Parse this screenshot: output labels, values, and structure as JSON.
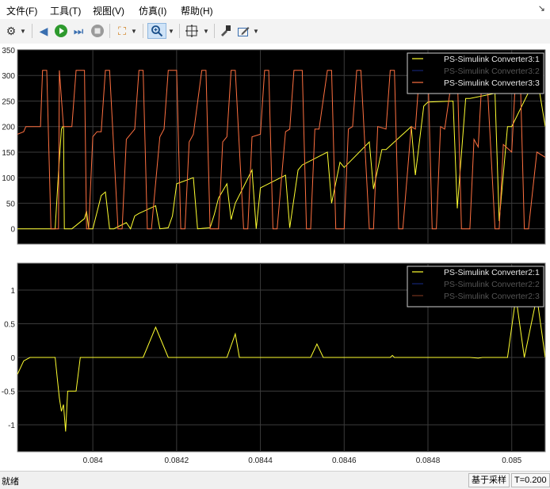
{
  "menu": [
    "文件(F)",
    "工具(T)",
    "视图(V)",
    "仿真(I)",
    "帮助(H)"
  ],
  "pin_glyph": "↘",
  "toolbar": {
    "settings": "⚙",
    "step_back": "◀",
    "run": "▶",
    "step_forward": "⏭",
    "stop": "■",
    "highlight": "⛶",
    "zoom": "🔍",
    "autoscale": "⊕",
    "style": "⚙",
    "edit": "✎"
  },
  "chart_data": [
    {
      "type": "line",
      "title": "",
      "xlim": [
        0.08382,
        0.08508
      ],
      "ylim": [
        -30,
        350
      ],
      "yticks": [
        0,
        50,
        100,
        150,
        200,
        250,
        300,
        350
      ],
      "legend": {
        "placement": "top-right"
      },
      "series": [
        {
          "name": "PS-Simulink Converter3:1",
          "color": "#ffff30",
          "enabled": true,
          "x": [
            0.08382,
            0.0839,
            0.08391,
            0.083918,
            0.083925,
            0.083928,
            0.08393,
            0.083932,
            0.08394,
            0.08395,
            0.08398,
            0.083985,
            0.08399,
            0.084,
            0.08402,
            0.08403,
            0.08404,
            0.08405,
            0.08408,
            0.08409,
            0.0841,
            0.08411,
            0.08415,
            0.08416,
            0.08418,
            0.08419,
            0.0842,
            0.08424,
            0.08425,
            0.08428,
            0.08429,
            0.0843,
            0.08432,
            0.08433,
            0.08434,
            0.08438,
            0.08439,
            0.0844,
            0.08446,
            0.08447,
            0.08449,
            0.0845,
            0.08456,
            0.08457,
            0.08459,
            0.0846,
            0.08466,
            0.08467,
            0.08469,
            0.0847,
            0.08476,
            0.08477,
            0.08479,
            0.0848,
            0.08486,
            0.08487,
            0.08489,
            0.0849,
            0.08496,
            0.08497,
            0.08499,
            0.085,
            0.08506,
            0.08508
          ],
          "y": [
            0,
            0,
            0,
            110,
            195,
            200,
            200,
            0,
            0,
            0,
            20,
            35,
            0,
            0,
            65,
            72,
            0,
            0,
            12,
            0,
            25,
            30,
            45,
            0,
            2,
            25,
            88,
            100,
            0,
            2,
            28,
            60,
            88,
            18,
            50,
            115,
            0,
            80,
            105,
            2,
            115,
            125,
            150,
            50,
            130,
            120,
            170,
            78,
            155,
            155,
            200,
            105,
            240,
            248,
            250,
            40,
            255,
            255,
            265,
            15,
            200,
            200,
            300,
            200
          ]
        },
        {
          "name": "PS-Simulink Converter3:2",
          "color": "#3050ff",
          "enabled": false,
          "x": [],
          "y": []
        },
        {
          "name": "PS-Simulink Converter3:3",
          "color": "#ff7040",
          "enabled": true,
          "x": [
            0.08382,
            0.083835,
            0.08384,
            0.083875,
            0.08388,
            0.08389,
            0.0839,
            0.083918,
            0.08392,
            0.08393,
            0.08395,
            0.08396,
            0.08398,
            0.083985,
            0.08399,
            0.084,
            0.08401,
            0.08402,
            0.08403,
            0.08404,
            0.08406,
            0.08407,
            0.08408,
            0.0841,
            0.08411,
            0.08412,
            0.08413,
            0.08414,
            0.08416,
            0.08417,
            0.08418,
            0.0842,
            0.08421,
            0.08422,
            0.08423,
            0.08424,
            0.08426,
            0.08427,
            0.08428,
            0.0843,
            0.08431,
            0.08432,
            0.08433,
            0.08434,
            0.08436,
            0.08437,
            0.08438,
            0.0844,
            0.08441,
            0.08442,
            0.08443,
            0.08444,
            0.08446,
            0.08447,
            0.08448,
            0.0845,
            0.08451,
            0.08452,
            0.08453,
            0.08454,
            0.08456,
            0.08457,
            0.08458,
            0.0846,
            0.08461,
            0.08462,
            0.08463,
            0.08464,
            0.08466,
            0.08467,
            0.08468,
            0.0847,
            0.08471,
            0.08472,
            0.08473,
            0.08474,
            0.08476,
            0.08477,
            0.08478,
            0.0848,
            0.08481,
            0.08482,
            0.08483,
            0.08484,
            0.08486,
            0.08487,
            0.08488,
            0.0849,
            0.08491,
            0.08492,
            0.08493,
            0.08494,
            0.08496,
            0.08497,
            0.08498,
            0.085,
            0.08501,
            0.08502,
            0.08503,
            0.08504,
            0.08506,
            0.08508
          ],
          "y": [
            185,
            190,
            200,
            200,
            310,
            310,
            0,
            0,
            310,
            200,
            200,
            310,
            310,
            0,
            0,
            180,
            190,
            190,
            310,
            310,
            0,
            0,
            175,
            195,
            310,
            310,
            0,
            0,
            180,
            195,
            310,
            310,
            0,
            0,
            170,
            185,
            310,
            310,
            0,
            0,
            170,
            180,
            310,
            310,
            0,
            0,
            180,
            185,
            310,
            310,
            0,
            0,
            190,
            195,
            310,
            310,
            0,
            0,
            195,
            195,
            310,
            310,
            0,
            0,
            195,
            200,
            310,
            310,
            0,
            0,
            200,
            195,
            310,
            310,
            0,
            0,
            200,
            195,
            310,
            310,
            0,
            0,
            200,
            195,
            310,
            310,
            0,
            0,
            175,
            160,
            310,
            310,
            0,
            0,
            165,
            150,
            310,
            310,
            0,
            0,
            150,
            140
          ]
        }
      ]
    },
    {
      "type": "line",
      "title": "",
      "xlim": [
        0.08382,
        0.08508
      ],
      "ylim": [
        -1.4,
        1.4
      ],
      "yticks": [
        -1,
        -0.5,
        0,
        0.5,
        1
      ],
      "xticks": [
        0.084,
        0.0842,
        0.0844,
        0.0846,
        0.0848,
        0.085
      ],
      "xticklabels": [
        "0.084",
        "0.0842",
        "0.0844",
        "0.0846",
        "0.0848",
        "0.085"
      ],
      "legend": {
        "placement": "top-right"
      },
      "series": [
        {
          "name": "PS-Simulink Converter2:1",
          "color": "#ffff30",
          "enabled": true,
          "x": [
            0.08382,
            0.083835,
            0.08385,
            0.08391,
            0.083915,
            0.08392,
            0.083925,
            0.08393,
            0.083935,
            0.08394,
            0.08396,
            0.08397,
            0.08398,
            0.08412,
            0.08415,
            0.08416,
            0.08418,
            0.08419,
            0.08432,
            0.08434,
            0.08435,
            0.08452,
            0.084535,
            0.08455,
            0.08471,
            0.084715,
            0.08472,
            0.0849,
            0.08492,
            0.08493,
            0.08499,
            0.08501,
            0.08503,
            0.08506,
            0.08508
          ],
          "y": [
            -0.25,
            -0.05,
            0,
            0,
            -0.3,
            -0.6,
            -0.8,
            -0.7,
            -1.1,
            -0.5,
            -0.5,
            0,
            0,
            0,
            0.45,
            0.3,
            0,
            0,
            0,
            0.35,
            0,
            0,
            0.2,
            0,
            0,
            0.03,
            0,
            0,
            -0.01,
            0,
            0,
            0.9,
            0,
            0.9,
            0
          ]
        },
        {
          "name": "PS-Simulink Converter2:2",
          "color": "#3050ff",
          "enabled": false,
          "x": [],
          "y": []
        },
        {
          "name": "PS-Simulink Converter2:3",
          "color": "#ff7040",
          "enabled": false,
          "x": [],
          "y": []
        }
      ]
    }
  ],
  "status": {
    "left": "就绪",
    "mode": "基于采样",
    "time": "T=0.200"
  }
}
